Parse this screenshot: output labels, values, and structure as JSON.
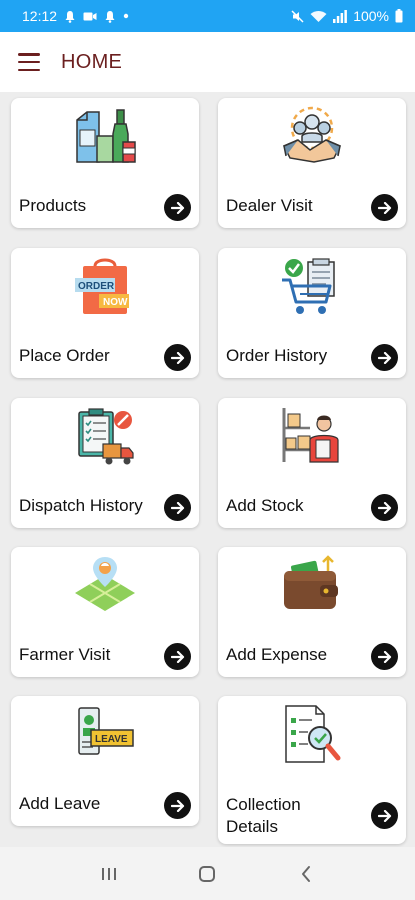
{
  "status_bar": {
    "time": "12:12",
    "battery": "100%",
    "left_icons": [
      "notification-bell-icon",
      "video-icon",
      "notification-bell-icon",
      "dot-icon"
    ],
    "right_icons": [
      "mute-icon",
      "wifi-icon",
      "signal-icon",
      "battery-icon"
    ]
  },
  "app_bar": {
    "title": "HOME",
    "menu_icon": "hamburger-menu-icon"
  },
  "tiles": [
    {
      "label": "Products",
      "icon": "products-icon"
    },
    {
      "label": "Dealer Visit",
      "icon": "dealer-visit-icon"
    },
    {
      "label": "Place Order",
      "icon": "place-order-icon",
      "art_text": [
        "ORDER",
        "NOW"
      ]
    },
    {
      "label": "Order History",
      "icon": "order-history-icon"
    },
    {
      "label": "Dispatch History",
      "icon": "dispatch-history-icon"
    },
    {
      "label": "Add Stock",
      "icon": "add-stock-icon"
    },
    {
      "label": "Farmer Visit",
      "icon": "farmer-visit-icon"
    },
    {
      "label": "Add Expense",
      "icon": "add-expense-icon"
    },
    {
      "label": "Add Leave",
      "icon": "add-leave-icon",
      "art_text": [
        "LEAVE"
      ]
    },
    {
      "label": "Collection Details",
      "icon": "collection-details-icon"
    }
  ],
  "nav_bar": {
    "buttons": [
      "recent-apps-icon",
      "home-icon",
      "back-icon"
    ]
  },
  "colors": {
    "status_bar": "#20a4f3",
    "title": "#6b1f1f",
    "card": "#ffffff",
    "background": "#ededed",
    "arrow_button": "#111111"
  }
}
